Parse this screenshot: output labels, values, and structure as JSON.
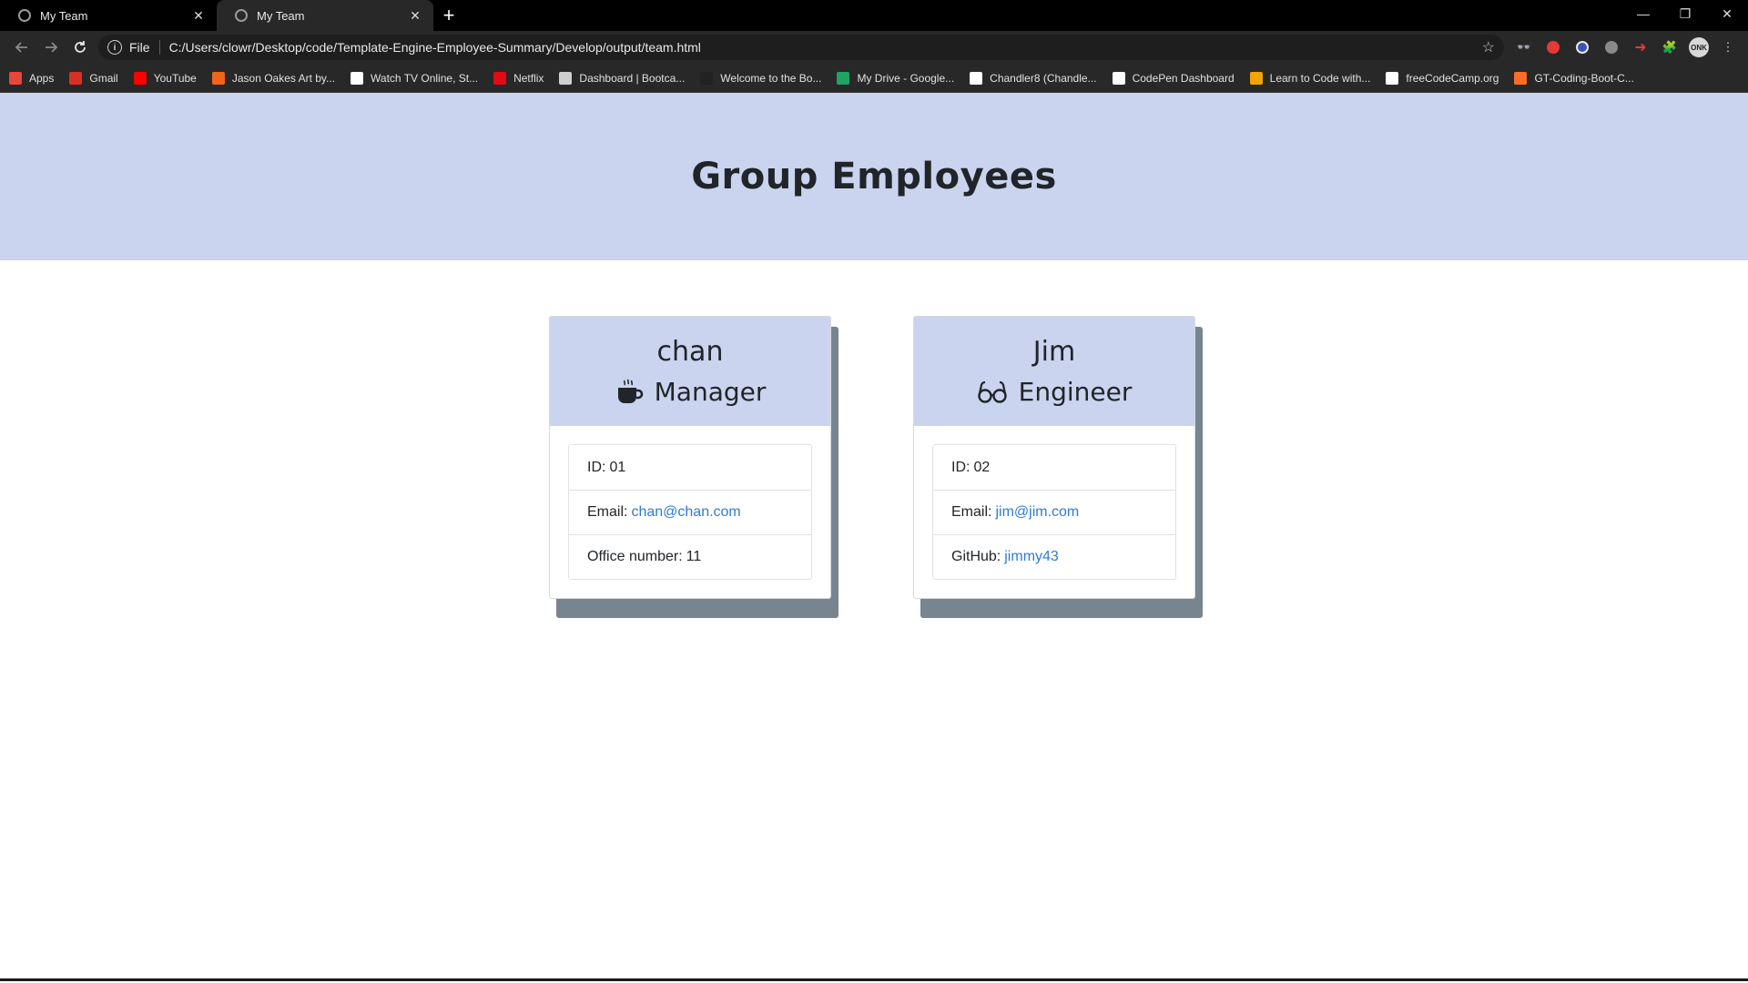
{
  "browser": {
    "tabs": [
      {
        "title": "My Team",
        "active": false
      },
      {
        "title": "My Team",
        "active": true
      }
    ],
    "address": {
      "scheme": "File",
      "url": "C:/Users/clowr/Desktop/code/Template-Engine-Employee-Summary/Develop/output/team.html"
    },
    "avatar_text": "ONK",
    "bookmarks": [
      {
        "label": "Apps",
        "icon": "apps-grid-icon",
        "color": "#e8453c"
      },
      {
        "label": "Gmail",
        "icon": "gmail-icon",
        "color": "#d93025"
      },
      {
        "label": "YouTube",
        "icon": "youtube-icon",
        "color": "#ff0000"
      },
      {
        "label": "Jason Oakes Art by...",
        "icon": "etsy-icon",
        "color": "#f1641e"
      },
      {
        "label": "Watch TV Online, St...",
        "icon": "x-icon",
        "color": "#ffffff"
      },
      {
        "label": "Netflix",
        "icon": "netflix-icon",
        "color": "#e50914"
      },
      {
        "label": "Dashboard | Bootca...",
        "icon": "globe-icon",
        "color": "#cfcfcf"
      },
      {
        "label": "Welcome to the Bo...",
        "icon": "book-icon",
        "color": "#222222"
      },
      {
        "label": "My Drive - Google...",
        "icon": "google-drive-icon",
        "color": "#1fa463"
      },
      {
        "label": "Chandler8 (Chandle...",
        "icon": "github-icon",
        "color": "#ffffff"
      },
      {
        "label": "CodePen Dashboard",
        "icon": "codepen-icon",
        "color": "#ffffff"
      },
      {
        "label": "Learn to Code with...",
        "icon": "code-icon",
        "color": "#f0a500"
      },
      {
        "label": "freeCodeCamp.org",
        "icon": "freecodecamp-icon",
        "color": "#ffffff"
      },
      {
        "label": "GT-Coding-Boot-C...",
        "icon": "gitlab-icon",
        "color": "#fc6d26"
      }
    ]
  },
  "page": {
    "title": "Group Employees",
    "accent_color": "#cad4ef",
    "link_color": "#2e7bd6",
    "shadow_color": "#778591"
  },
  "employees": [
    {
      "name": "chan",
      "role": "Manager",
      "role_icon": "coffee-mug-icon",
      "id_label": "ID:",
      "id": "01",
      "email_label": "Email:",
      "email": "chan@chan.com",
      "extra_label": "Office number:",
      "extra": "11"
    },
    {
      "name": "Jim",
      "role": "Engineer",
      "role_icon": "glasses-icon",
      "id_label": "ID:",
      "id": "02",
      "email_label": "Email:",
      "email": "jim@jim.com",
      "extra_label": "GitHub:",
      "extra": "jimmy43"
    }
  ]
}
